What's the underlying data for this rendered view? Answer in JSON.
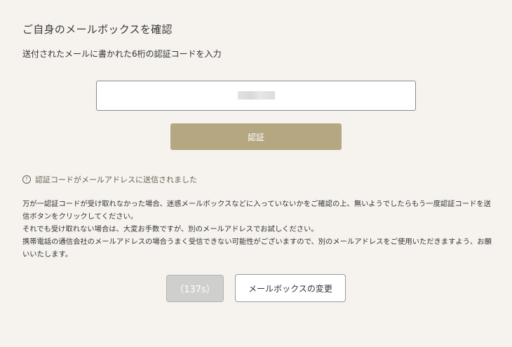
{
  "header": {
    "title": "ご自身のメールボックスを確認",
    "subtitle": "送付されたメールに書かれた6桁の認証コードを入力"
  },
  "code_input": {
    "value": "",
    "placeholder": ""
  },
  "verify_button": {
    "label": "認証"
  },
  "notice": {
    "icon": "info-circle-icon",
    "text": "認証コードがメールアドレスに送信されました"
  },
  "help": {
    "lines": [
      "万が一認証コードが受け取れなかった場合、迷惑メールボックスなどに入っていないかをご確認の上、無いようでしたらもう一度認証コードを送信ボタンをクリックしてください。",
      "それでも受け取れない場合は、大変お手数ですが、別のメールアドレスでお試しください。",
      "携帯電話の通信会社のメールアドレスの場合うまく受信できない可能性がございますので、別のメールアドレスをご使用いただきますよう、お願いいたします。"
    ]
  },
  "resend_button": {
    "label": "（137s）",
    "disabled": true
  },
  "change_button": {
    "label": "メールボックスの変更"
  }
}
